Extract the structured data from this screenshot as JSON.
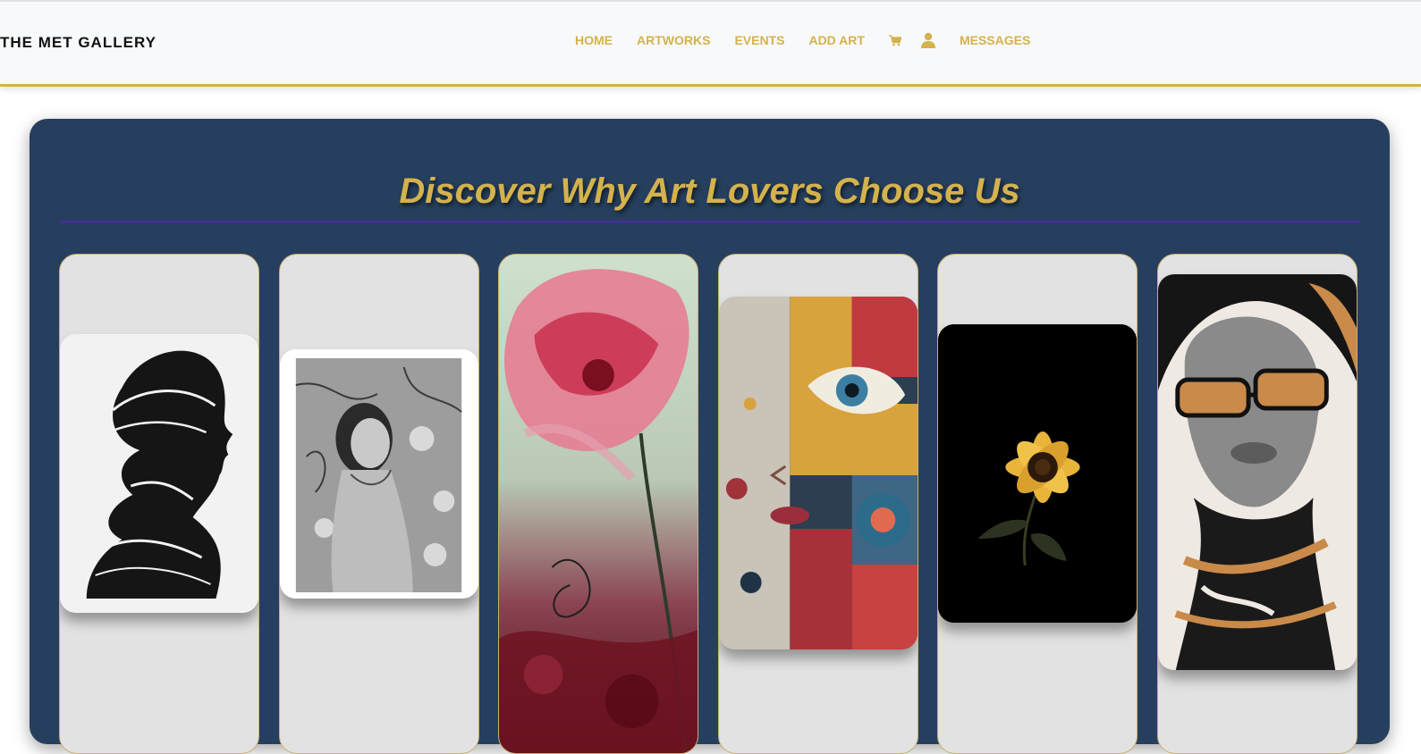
{
  "header": {
    "brand": "THE MET GALLERY",
    "nav": {
      "home": "HOME",
      "artworks": "ARTWORKS",
      "events": "EVENTS",
      "add_art": "ADD ART",
      "messages": "MESSAGES"
    },
    "icons": {
      "cart": "cart-icon",
      "user": "user-icon"
    }
  },
  "hero": {
    "title": "Discover Why Art Lovers Choose Us"
  },
  "artworks": [
    {
      "subject": "ink brush profile portrait"
    },
    {
      "subject": "pencil portrait of a woman with blossoms"
    },
    {
      "subject": "pink flower abstract"
    },
    {
      "subject": "cubist face with eye"
    },
    {
      "subject": "sunflower on black"
    },
    {
      "subject": "woman with orange sunglasses"
    }
  ],
  "colors": {
    "accent_gold": "#d4b24c",
    "section_navy": "#263f5e",
    "card_bg": "#e2e2e2",
    "rule_purple": "#4a2aa0"
  }
}
